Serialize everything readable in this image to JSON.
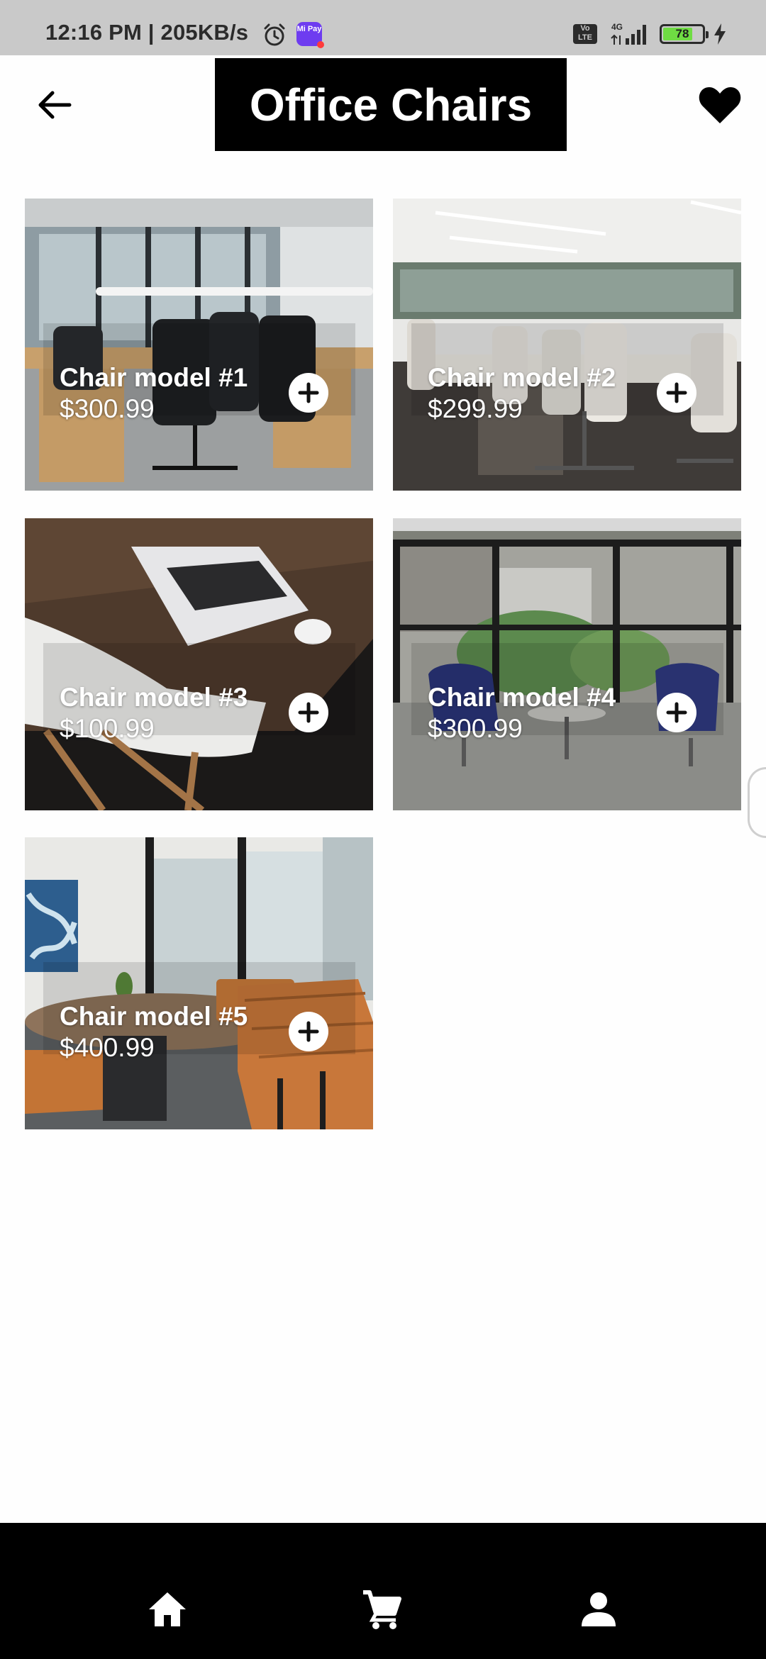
{
  "status_bar": {
    "time_speed": "12:16 PM | 205KB/s",
    "mipay_label": "Mi Pay",
    "volte_label": "Vo LTE",
    "network_label": "4G",
    "battery_level": "78",
    "icons": [
      "alarm-icon",
      "mipay-icon",
      "volte-icon",
      "signal-icon",
      "battery-icon",
      "charging-icon"
    ]
  },
  "header": {
    "title": "Office Chairs",
    "back_icon": "arrow-left-icon",
    "favorite_icon": "heart-icon"
  },
  "products": [
    {
      "name": "Chair model #1",
      "price": "$300.99",
      "add_icon": "plus-circle-icon"
    },
    {
      "name": "Chair model #2",
      "price": "$299.99",
      "add_icon": "plus-circle-icon"
    },
    {
      "name": "Chair model #3",
      "price": "$100.99",
      "add_icon": "plus-circle-icon"
    },
    {
      "name": "Chair model #4",
      "price": "$300.99",
      "add_icon": "plus-circle-icon"
    },
    {
      "name": "Chair model #5",
      "price": "$400.99",
      "add_icon": "plus-circle-icon"
    }
  ],
  "bottom_nav": {
    "items": [
      "home-icon",
      "cart-icon",
      "profile-icon"
    ]
  },
  "colors": {
    "status_bar_bg": "#c9c9c9",
    "title_bg": "#000000",
    "title_text": "#ffffff",
    "nav_bg": "#000000",
    "battery_fill": "#6fdc43"
  }
}
